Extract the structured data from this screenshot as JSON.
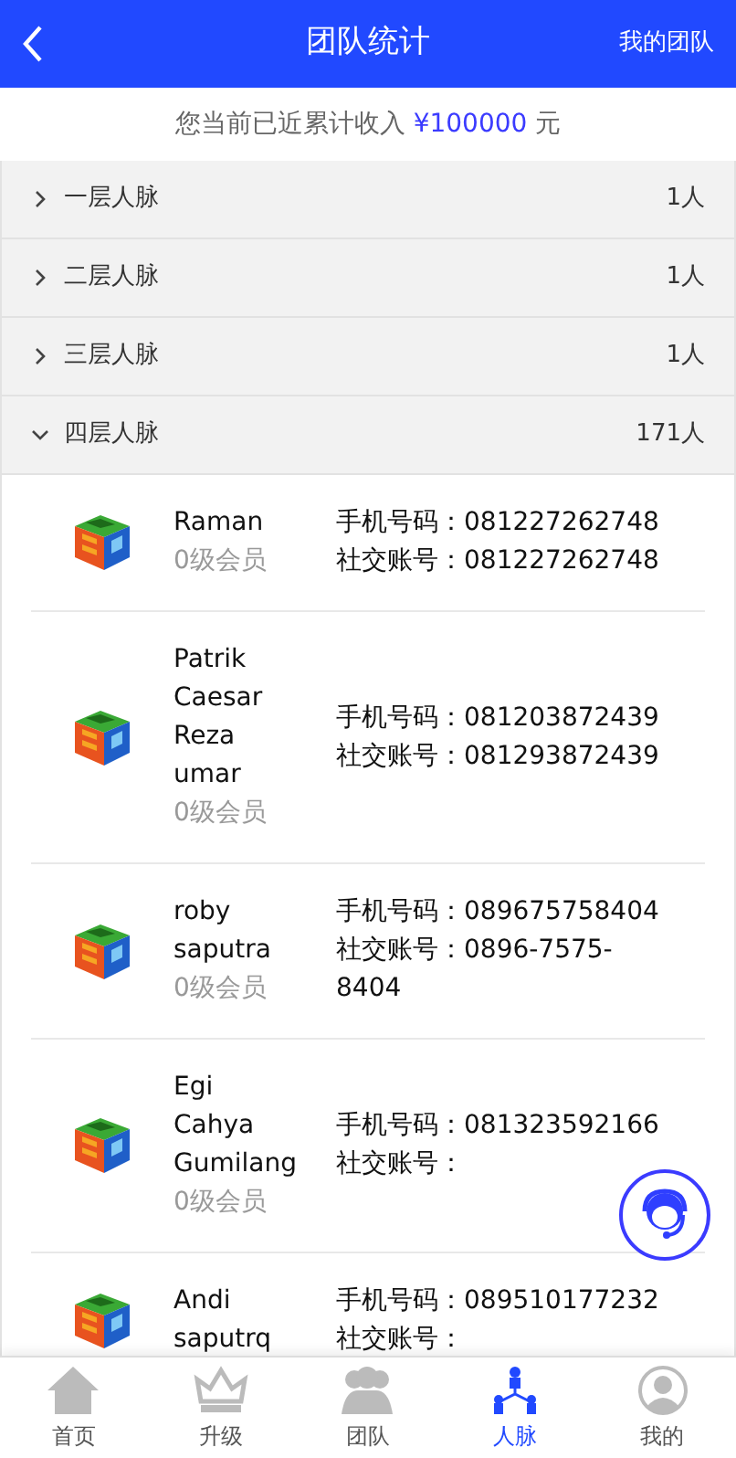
{
  "header": {
    "title": "团队统计",
    "action": "我的团队"
  },
  "summary": {
    "text": "您当前已近累计收入",
    "amount": "¥100000",
    "unit": "元"
  },
  "levels": [
    {
      "label": "一层人脉",
      "count": "1人",
      "expanded": false
    },
    {
      "label": "二层人脉",
      "count": "1人",
      "expanded": false
    },
    {
      "label": "三层人脉",
      "count": "1人",
      "expanded": false
    },
    {
      "label": "四层人脉",
      "count": "171人",
      "expanded": true
    }
  ],
  "members": [
    {
      "name": "Raman",
      "rank": "0级会员",
      "phone_line": "手机号码：081227262748",
      "social_line": "社交账号：081227262748"
    },
    {
      "name": "Patrik Caesar Reza umar",
      "rank": "0级会员",
      "phone_line": "手机号码：081203872439",
      "social_line": "社交账号：081293872439"
    },
    {
      "name": "roby saputra",
      "rank": "0级会员",
      "phone_line": "手机号码：089675758404",
      "social_line": "社交账号：0896-7575-8404"
    },
    {
      "name": "Egi Cahya Gumilang",
      "rank": "0级会员",
      "phone_line": "手机号码：081323592166",
      "social_line": "社交账号："
    },
    {
      "name": "Andi saputrq",
      "phone_line": "手机号码：089510177232",
      "social_line": "社交账号："
    }
  ],
  "tabbar": [
    {
      "label": "首页",
      "kind": "home",
      "selected": false
    },
    {
      "label": "升级",
      "kind": "crown",
      "selected": false
    },
    {
      "label": "团队",
      "kind": "people",
      "selected": false
    },
    {
      "label": "人脉",
      "kind": "network",
      "selected": true
    },
    {
      "label": "我的",
      "kind": "user",
      "selected": false
    }
  ]
}
